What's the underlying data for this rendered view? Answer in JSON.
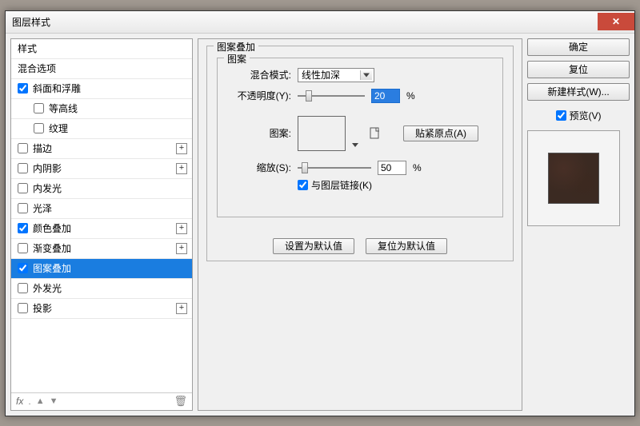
{
  "window": {
    "title": "图层样式"
  },
  "sidebar": {
    "items": [
      {
        "label": "样式",
        "type": "header"
      },
      {
        "label": "混合选项",
        "type": "header"
      },
      {
        "label": "斜面和浮雕",
        "type": "check",
        "checked": true
      },
      {
        "label": "等高线",
        "type": "check",
        "indent": true
      },
      {
        "label": "纹理",
        "type": "check",
        "indent": true
      },
      {
        "label": "描边",
        "type": "check",
        "plus": true
      },
      {
        "label": "内阴影",
        "type": "check",
        "plus": true
      },
      {
        "label": "内发光",
        "type": "check"
      },
      {
        "label": "光泽",
        "type": "check"
      },
      {
        "label": "颜色叠加",
        "type": "check",
        "checked": true,
        "plus": true
      },
      {
        "label": "渐变叠加",
        "type": "check",
        "plus": true
      },
      {
        "label": "图案叠加",
        "type": "check",
        "checked": true,
        "selected": true
      },
      {
        "label": "外发光",
        "type": "check"
      },
      {
        "label": "投影",
        "type": "check",
        "plus": true
      }
    ],
    "footer_fx": "fx"
  },
  "panel": {
    "group_title": "图案叠加",
    "inner_title": "图案",
    "blend_label": "混合模式:",
    "blend_value": "线性加深",
    "opacity_label": "不透明度(Y):",
    "opacity_value": "20",
    "percent": "%",
    "pattern_label": "图案:",
    "snap_label": "贴紧原点(A)",
    "scale_label": "缩放(S):",
    "scale_value": "50",
    "link_label": "与图层链接(K)",
    "set_default": "设置为默认值",
    "reset_default": "复位为默认值"
  },
  "right": {
    "ok": "确定",
    "reset": "复位",
    "new_style": "新建样式(W)...",
    "preview": "预览(V)"
  }
}
